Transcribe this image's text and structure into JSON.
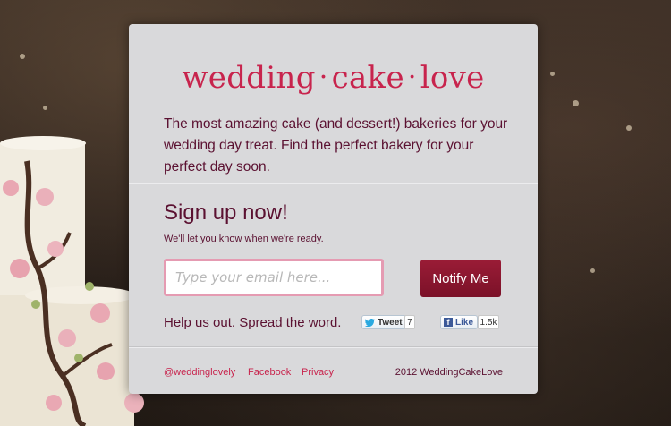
{
  "brand": {
    "part1": "wedding",
    "part2": "cake",
    "part3": "love",
    "separator": "·"
  },
  "intro": "The most amazing cake (and dessert!) bakeries for your wedding day treat. Find the perfect bakery for your perfect day soon.",
  "signup": {
    "title": "Sign up now!",
    "subtitle": "We'll let you know when we're ready.",
    "email_placeholder": "Type your email here...",
    "button_label": "Notify Me"
  },
  "share": {
    "text": "Help us out. Spread the word.",
    "tweet_label": "Tweet",
    "tweet_count": "7",
    "like_label": "Like",
    "like_count": "1.5k"
  },
  "footer": {
    "links": [
      "@weddinglovely",
      "Facebook",
      "Privacy"
    ],
    "copyright": "2012 WeddingCakeLove"
  },
  "colors": {
    "brand": "#c8244d",
    "text": "#5b1131",
    "button": "#8a1630",
    "card": "#d9d9db"
  }
}
